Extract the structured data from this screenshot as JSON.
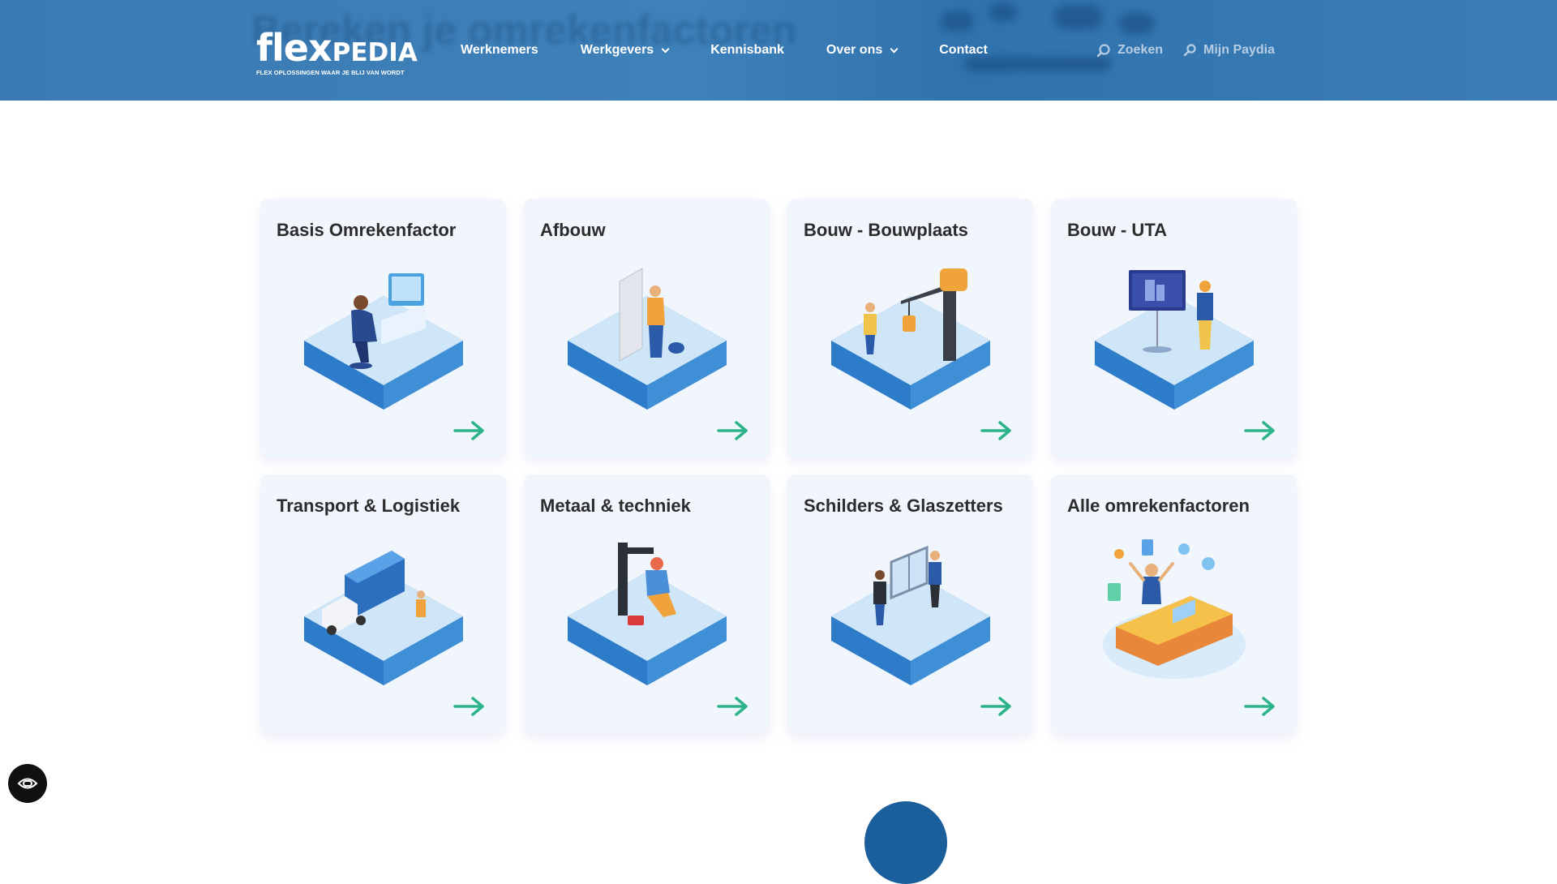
{
  "header": {
    "ghost_text": "Bereken je omrekenfactoren",
    "logo": {
      "main": "flex",
      "accent": "PEDIA",
      "tagline": "FLEX OPLOSSINGEN WAAR JE BLIJ VAN WORDT"
    },
    "nav": [
      {
        "label": "Werknemers",
        "has_dropdown": false
      },
      {
        "label": "Werkgevers",
        "has_dropdown": true
      },
      {
        "label": "Kennisbank",
        "has_dropdown": false
      },
      {
        "label": "Over ons",
        "has_dropdown": true
      },
      {
        "label": "Contact",
        "has_dropdown": false
      }
    ],
    "search_label": "Zoeken",
    "account_label": "Mijn Paydia",
    "search_icon": "search-icon",
    "account_icon": "key-icon"
  },
  "cards": [
    {
      "title": "Basis Omrekenfactor",
      "icon": "office-worker-illustration"
    },
    {
      "title": "Afbouw",
      "icon": "plasterer-illustration"
    },
    {
      "title": "Bouw - Bouwplaats",
      "icon": "crane-illustration"
    },
    {
      "title": "Bouw - UTA",
      "icon": "presentation-board-illustration"
    },
    {
      "title": "Transport & Logistiek",
      "icon": "truck-illustration"
    },
    {
      "title": "Metaal & techniek",
      "icon": "welder-illustration"
    },
    {
      "title": "Schilders & Glaszetters",
      "icon": "glazier-illustration"
    },
    {
      "title": "Alle omrekenfactoren",
      "icon": "dashboard-illustration"
    }
  ],
  "card_arrow_icon": "arrow-right-icon",
  "accessibility_icon": "accessibility-icon",
  "colors": {
    "header": "#3b7bb4",
    "card_bg": "#f1f5fc",
    "arrow": "#2bb389",
    "tile_light": "#cfe6f8",
    "tile_dark": "#2d7cc9",
    "accent_orange": "#f0a33a",
    "nav_muted": "#b7cde3"
  }
}
